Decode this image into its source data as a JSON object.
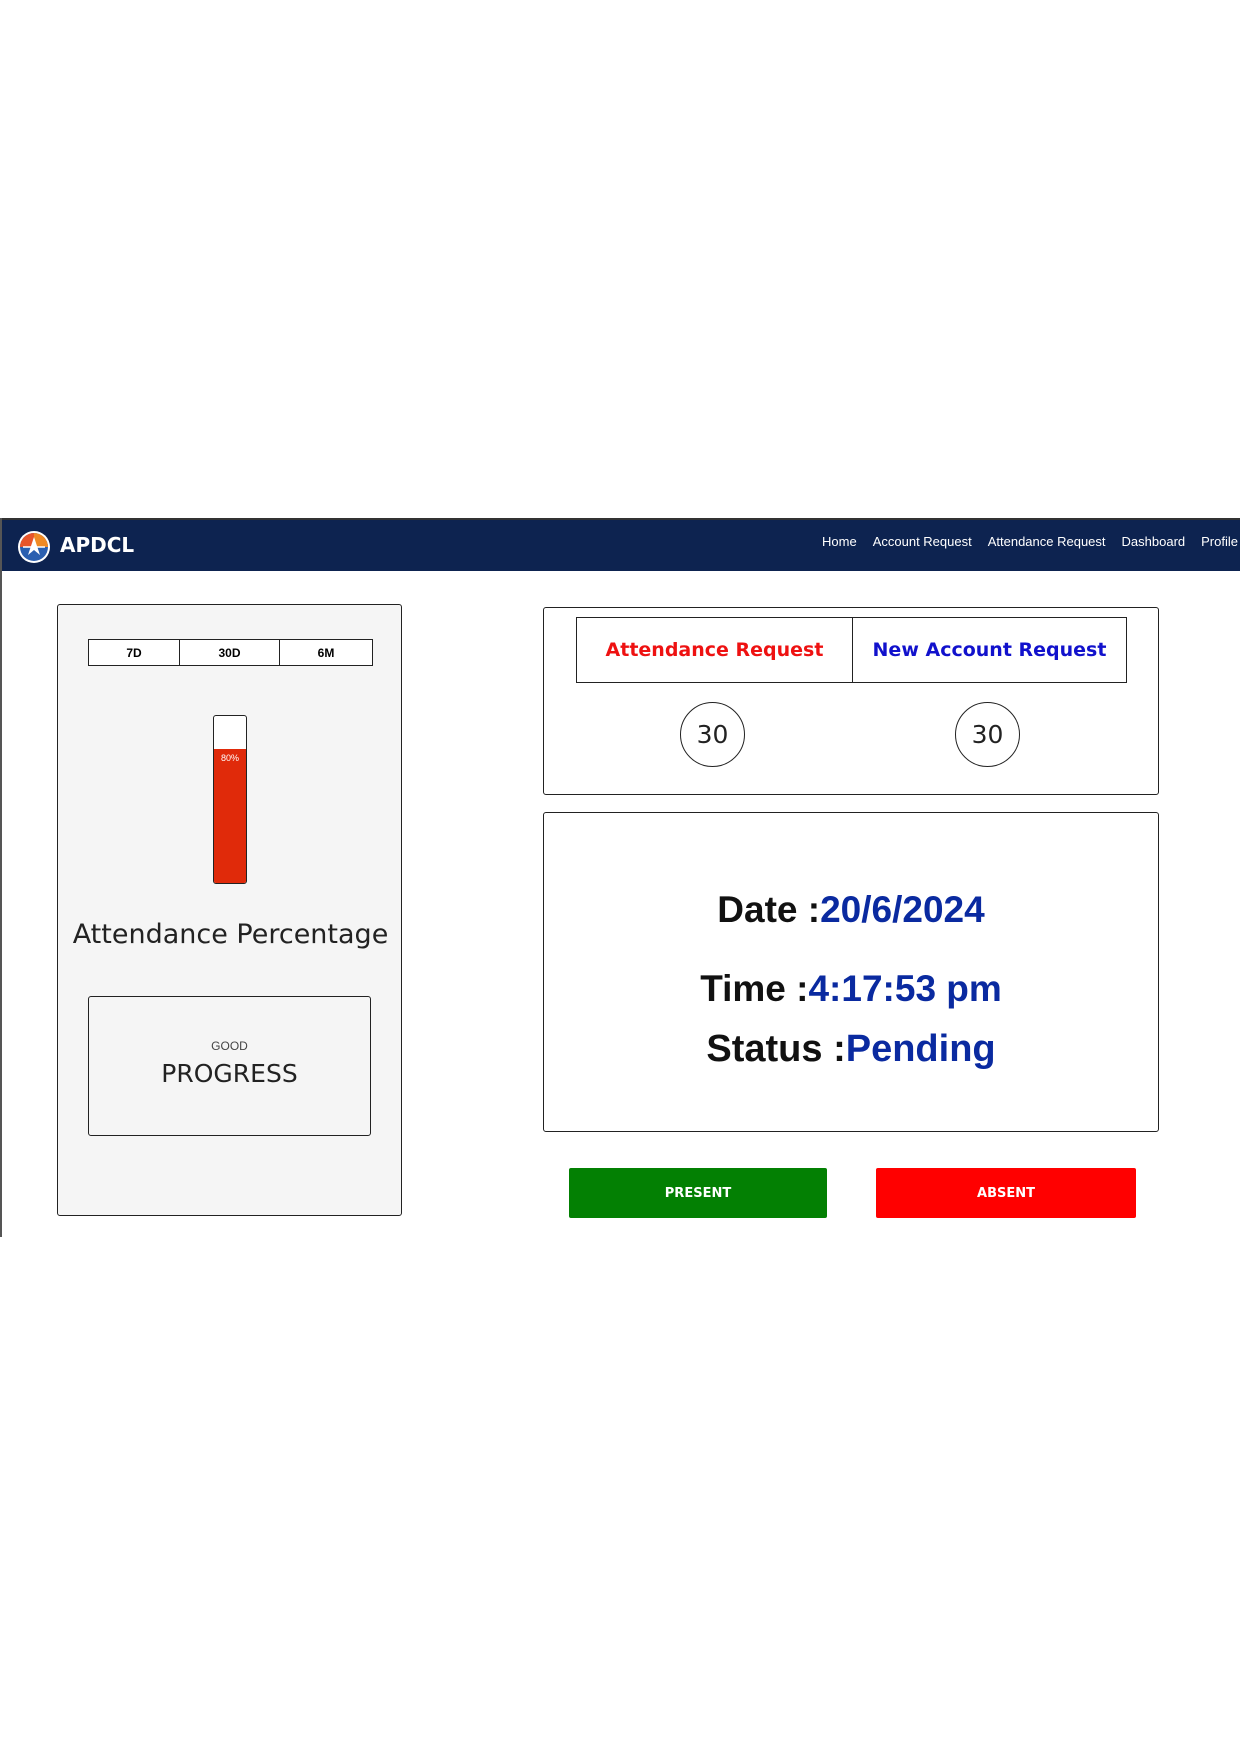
{
  "brand": {
    "name": "APDCL",
    "logo_icon": "apdcl-logo-icon"
  },
  "nav": {
    "items": [
      {
        "label": "Home"
      },
      {
        "label": "Account Request"
      },
      {
        "label": "Attendance Request"
      },
      {
        "label": "Dashboard"
      },
      {
        "label": "Profile"
      }
    ]
  },
  "range_tabs": [
    "7D",
    "30D",
    "6M"
  ],
  "gauge": {
    "percent": 80,
    "label": "80%",
    "fill_color": "#e02a0a"
  },
  "attendance_caption": "Attendance Percentage",
  "progress_card": {
    "small": "GOOD",
    "big": "PROGRESS"
  },
  "requests": {
    "attendance": {
      "label": "Attendance Request",
      "count": "30",
      "color": "#ee1111"
    },
    "account": {
      "label": "New Account Request",
      "count": "30",
      "color": "#1111cc"
    }
  },
  "info": {
    "date_label": "Date :",
    "date_value": "20/6/2024",
    "time_label": "Time :",
    "time_value": "4:17:53 pm",
    "status_label": "Status :",
    "status_value": "Pending"
  },
  "actions": {
    "present_label": "PRESENT",
    "absent_label": "ABSENT",
    "present_color": "#038003",
    "absent_color": "#ff0000"
  },
  "colors": {
    "navbar": "#0d2350",
    "value_blue": "#0a2aa0"
  }
}
